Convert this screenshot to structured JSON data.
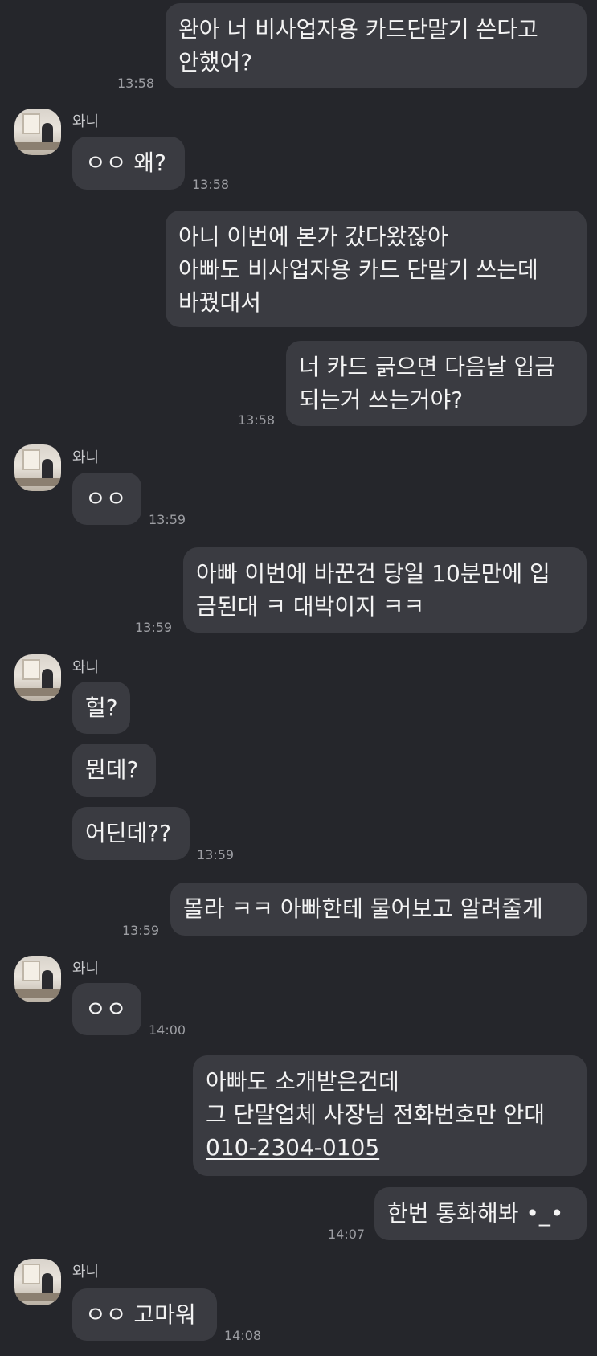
{
  "contact": {
    "name": "와니"
  },
  "messages": [
    {
      "id": "m1",
      "side": "out",
      "lines": [
        "완아 너 비사업자용 카드단말기 쓴다고",
        "안했어?"
      ],
      "time": "13:58"
    },
    {
      "id": "m2",
      "side": "in",
      "lines": [
        "ㅇㅇ 왜?"
      ],
      "time": "13:58"
    },
    {
      "id": "m3",
      "side": "out",
      "lines": [
        "아니 이번에 본가 갔다왔잖아",
        "아빠도 비사업자용 카드 단말기 쓰는데",
        "바꿨대서"
      ]
    },
    {
      "id": "m4",
      "side": "out",
      "lines": [
        "너 카드 긁으면 다음날 입금",
        "되는거 쓰는거야?"
      ],
      "time": "13:58"
    },
    {
      "id": "m5",
      "side": "in",
      "lines": [
        "ㅇㅇ"
      ],
      "time": "13:59"
    },
    {
      "id": "m6",
      "side": "out",
      "lines": [
        "아빠 이번에 바꾼건 당일 10분만에 입",
        "금된대 ㅋ 대박이지 ㅋㅋ"
      ],
      "time": "13:59"
    },
    {
      "id": "m7",
      "side": "in",
      "lines": [
        "헐?"
      ]
    },
    {
      "id": "m8",
      "side": "in",
      "lines": [
        "뭔데?"
      ]
    },
    {
      "id": "m9",
      "side": "in",
      "lines": [
        "어딘데??"
      ],
      "time": "13:59"
    },
    {
      "id": "m10",
      "side": "out",
      "lines": [
        "몰라 ㅋㅋ 아빠한테 물어보고 알려줄게"
      ],
      "time": "13:59"
    },
    {
      "id": "m11",
      "side": "in",
      "lines": [
        "ㅇㅇ"
      ],
      "time": "14:00"
    },
    {
      "id": "m12",
      "side": "out",
      "lines": [
        "아빠도 소개받은건데",
        "그 단말업체 사장님 전화번호만 안대",
        "010-2304-0105"
      ]
    },
    {
      "id": "m13",
      "side": "out",
      "lines": [
        "한번 통화해봐 •_•"
      ],
      "time": "14:07"
    },
    {
      "id": "m14",
      "side": "in",
      "lines": [
        "ㅇㅇ 고마워"
      ],
      "time": "14:08"
    }
  ]
}
